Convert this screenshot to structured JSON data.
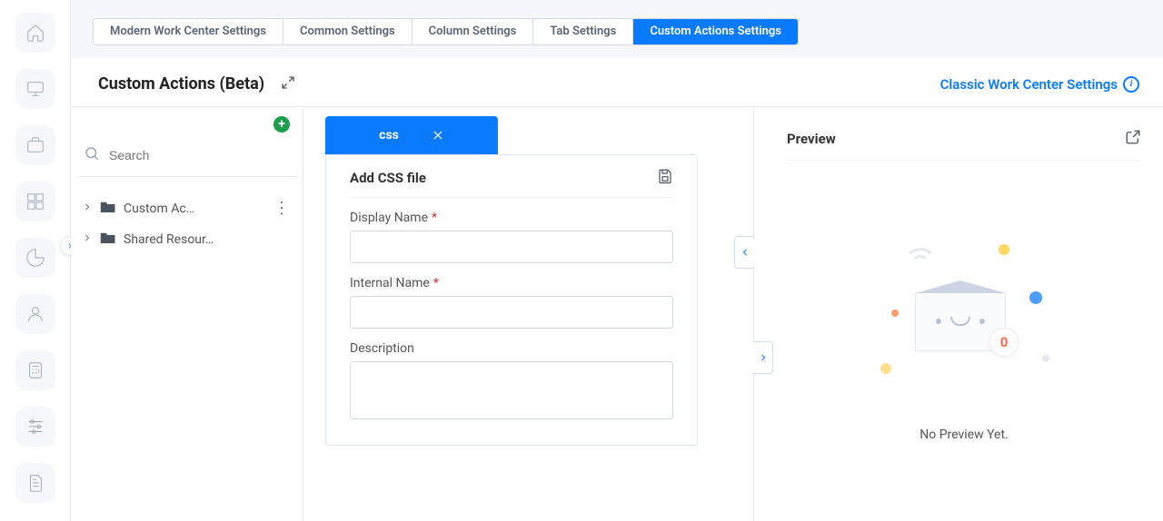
{
  "sidebar": {
    "items": [
      {
        "name": "home-icon"
      },
      {
        "name": "monitor-icon"
      },
      {
        "name": "briefcase-icon"
      },
      {
        "name": "grid-icon"
      },
      {
        "name": "pie-chart-icon"
      },
      {
        "name": "user-icon"
      },
      {
        "name": "calculator-icon"
      },
      {
        "name": "sliders-icon"
      },
      {
        "name": "document-icon"
      }
    ]
  },
  "tabs": [
    "Modern Work Center Settings",
    "Common Settings",
    "Column Settings",
    "Tab Settings",
    "Custom Actions Settings"
  ],
  "tabs_active_index": 4,
  "section": {
    "title": "Custom Actions (Beta)",
    "classic_link": "Classic Work Center Settings"
  },
  "tree": {
    "search_placeholder": "Search",
    "items": [
      {
        "label": "Custom Ac…",
        "has_menu": true
      },
      {
        "label": "Shared Resour…",
        "has_menu": false
      }
    ]
  },
  "editor": {
    "tab_label": "css",
    "form_title": "Add CSS file",
    "fields": {
      "display_name": {
        "label": "Display Name",
        "required": true,
        "value": ""
      },
      "internal_name": {
        "label": "Internal Name",
        "required": true,
        "value": ""
      },
      "description": {
        "label": "Description",
        "required": false,
        "value": ""
      }
    }
  },
  "preview": {
    "title": "Preview",
    "badge": "0",
    "empty_text": "No Preview Yet."
  }
}
